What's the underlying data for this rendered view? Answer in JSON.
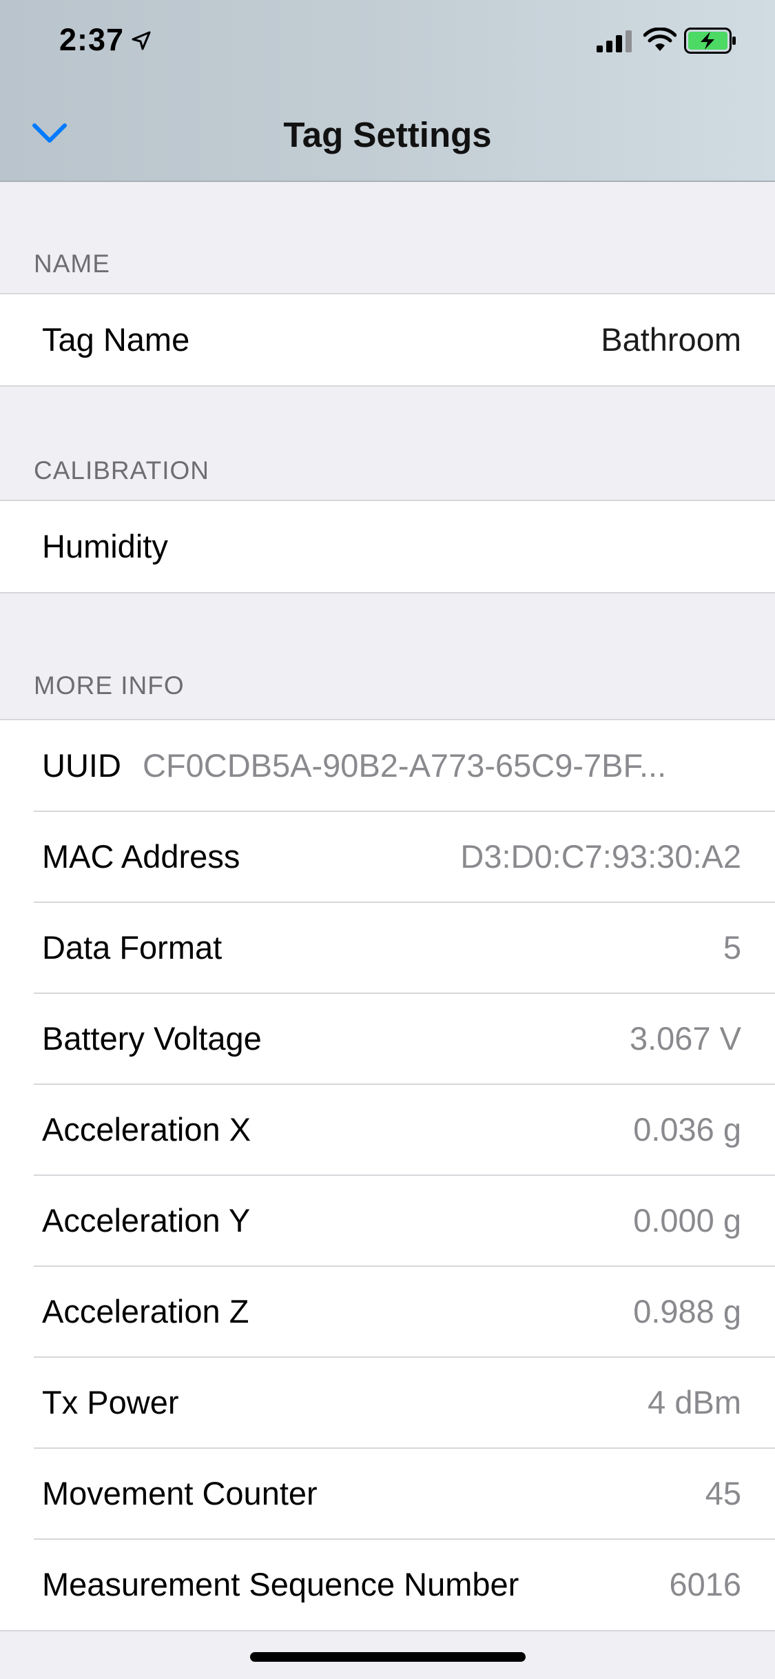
{
  "status_bar": {
    "time": "2:37",
    "icons": [
      "location-arrow-icon",
      "cellular-signal-icon",
      "wifi-icon",
      "battery-charging-icon"
    ],
    "battery_color": "#4CD964"
  },
  "nav": {
    "title": "Tag Settings",
    "back_icon": "chevron-down-icon",
    "accent_color": "#007AFF"
  },
  "sections": {
    "name": {
      "header": "NAME",
      "rows": [
        {
          "label": "Tag Name",
          "value": "Bathroom"
        }
      ]
    },
    "calibration": {
      "header": "CALIBRATION",
      "rows": [
        {
          "label": "Humidity"
        }
      ]
    },
    "more_info": {
      "header": "MORE INFO",
      "rows": [
        {
          "label": "UUID",
          "value": "CF0CDB5A-90B2-A773-65C9-7BF..."
        },
        {
          "label": "MAC Address",
          "value": "D3:D0:C7:93:30:A2"
        },
        {
          "label": "Data Format",
          "value": "5"
        },
        {
          "label": "Battery Voltage",
          "value": "3.067 V"
        },
        {
          "label": "Acceleration X",
          "value": "0.036 g"
        },
        {
          "label": "Acceleration Y",
          "value": "0.000 g"
        },
        {
          "label": "Acceleration Z",
          "value": "0.988 g"
        },
        {
          "label": "Tx Power",
          "value": "4 dBm"
        },
        {
          "label": "Movement Counter",
          "value": "45"
        },
        {
          "label": "Measurement Sequence Number",
          "value": "6016"
        }
      ]
    }
  }
}
